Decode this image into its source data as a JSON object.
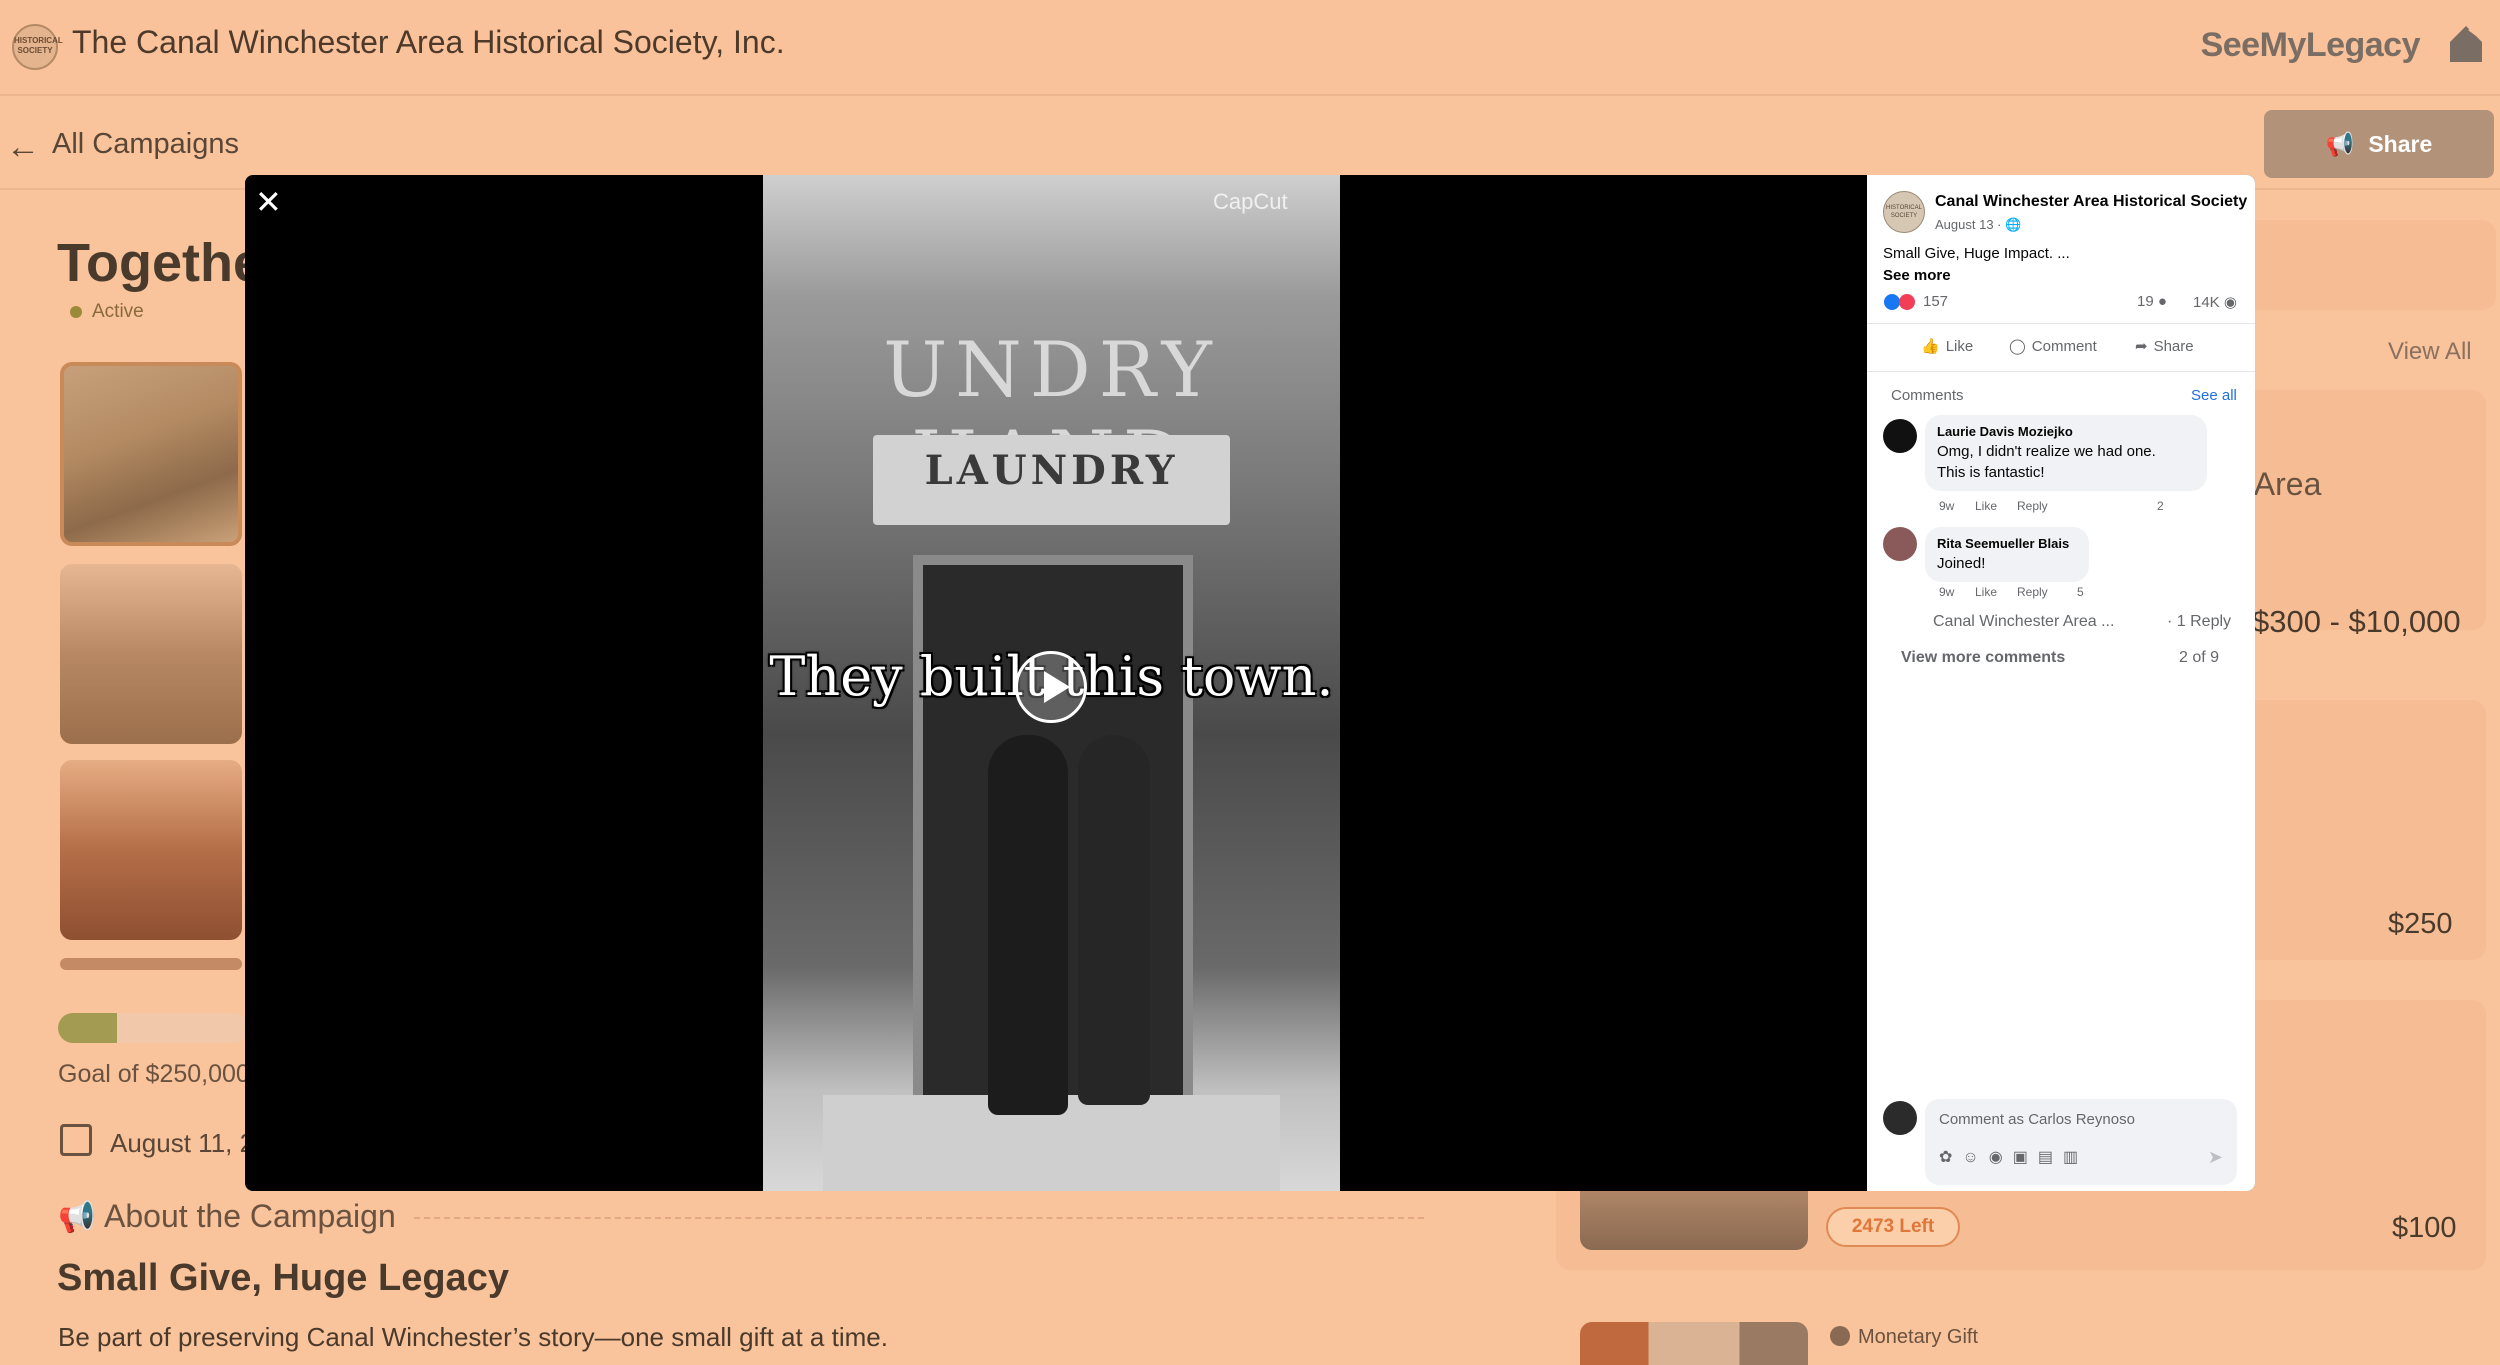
{
  "header": {
    "org_logo_text": "HISTORICAL SOCIETY",
    "org_name": "The Canal Winchester Area Historical Society, Inc.",
    "brand": "SeeMyLegacy"
  },
  "nav": {
    "back_label": "All Campaigns",
    "share_label": "Share"
  },
  "campaign": {
    "title_partial": "Togethe",
    "status": "Active",
    "goal_partial": "Goal of $250,000",
    "progress_percent": 31,
    "date_partial": "August 11, 2",
    "about_heading": "About the Campaign",
    "legacy_heading": "Small Give, Huge Legacy",
    "legacy_sub": "Be part of preserving Canal Winchester’s story—one small gift at a time."
  },
  "rewards": {
    "view_all": "View All",
    "area_partial": "r Area",
    "range": "$300 - $10,000",
    "price_250": "$250",
    "left_badge": "2473  Left",
    "price_100": "$100",
    "monetary": "Monetary Gift"
  },
  "video": {
    "sign_text": "UNDRY HAND",
    "awning_text": "LAUNDRY",
    "caption": "They built this town.",
    "watermark": "CapCut"
  },
  "facebook": {
    "avatar_text": "HISTORICAL SOCIETY",
    "page_name": "Canal Winchester Area Historical Society",
    "date": "August 13 · ",
    "post_text": "Small Give, Huge Impact. ...",
    "see_more": "See more",
    "reactions": "157",
    "comments_count": "19",
    "views": "14K",
    "actions": {
      "like": "Like",
      "comment": "Comment",
      "share": "Share"
    },
    "comments_heading": "Comments",
    "see_all": "See all",
    "comments": [
      {
        "name": "Laurie Davis Moziejko",
        "text1": "Omg, I didn't realize we had one.",
        "text2": "This is fantastic!",
        "time": "9w",
        "like": "Like",
        "reply": "Reply",
        "reactions": "2"
      },
      {
        "name": "Rita Seemueller Blais",
        "text1": "Joined!",
        "time": "9w",
        "like": "Like",
        "reply": "Reply",
        "reactions": "5"
      }
    ],
    "reply_author": "Canal Winchester Area ...",
    "reply_count": "· 1 Reply",
    "view_more": "View more comments",
    "pagination": "2 of 9",
    "input_placeholder": "Comment as Carlos Reynoso",
    "send_icon": "send-icon"
  }
}
